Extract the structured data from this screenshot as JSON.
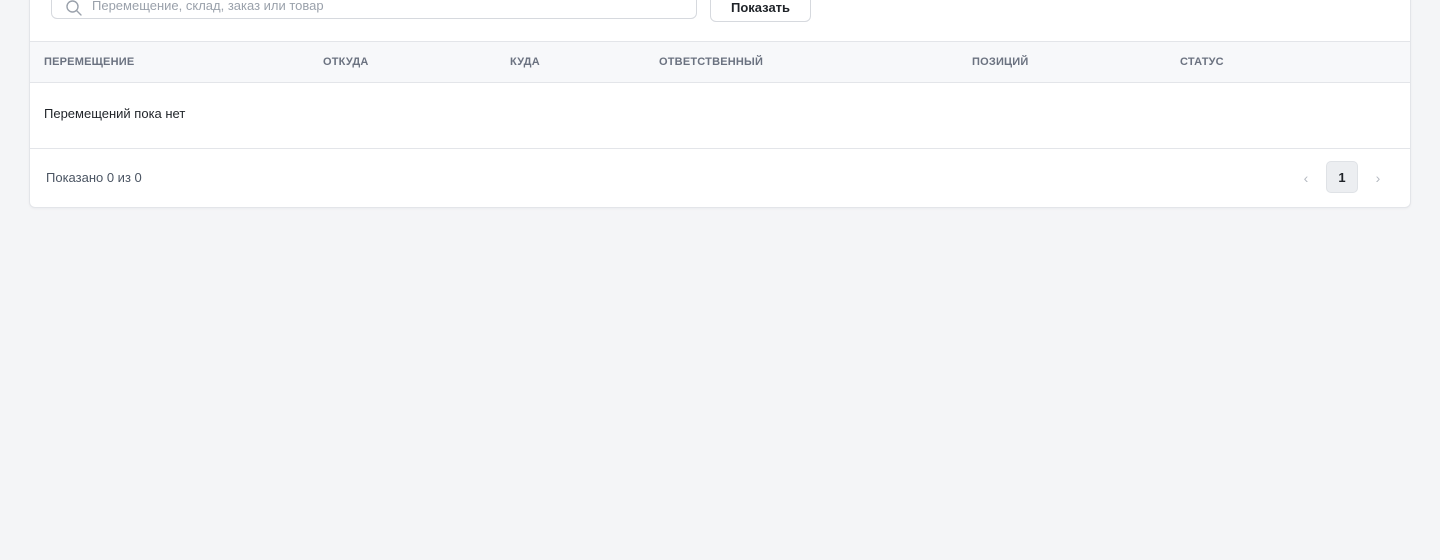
{
  "filters": {
    "search_placeholder": "Перемещение, склад, заказ или товар",
    "search_value": "",
    "show_button_label": "Показать"
  },
  "table": {
    "columns": [
      "ПЕРЕМЕЩЕНИЕ",
      "ОТКУДА",
      "КУДА",
      "ОТВЕТСТВЕННЫЙ",
      "ПОЗИЦИЙ",
      "СТАТУС"
    ],
    "empty_message": "Перемещений пока нет"
  },
  "footer": {
    "shown_text": "Показано 0 из 0",
    "pagination": {
      "prev_symbol": "‹",
      "current_page": "1",
      "next_symbol": "›"
    }
  },
  "icons": {
    "search": "search-icon",
    "prev": "chevron-left-icon",
    "next": "chevron-right-icon"
  },
  "colors": {
    "page_background": "#f4f5f7",
    "card_background": "#ffffff",
    "header_background": "#f7f8fa",
    "border": "#e3e5e9",
    "muted_text": "#6b7280",
    "current_page_background": "#eceef1"
  }
}
